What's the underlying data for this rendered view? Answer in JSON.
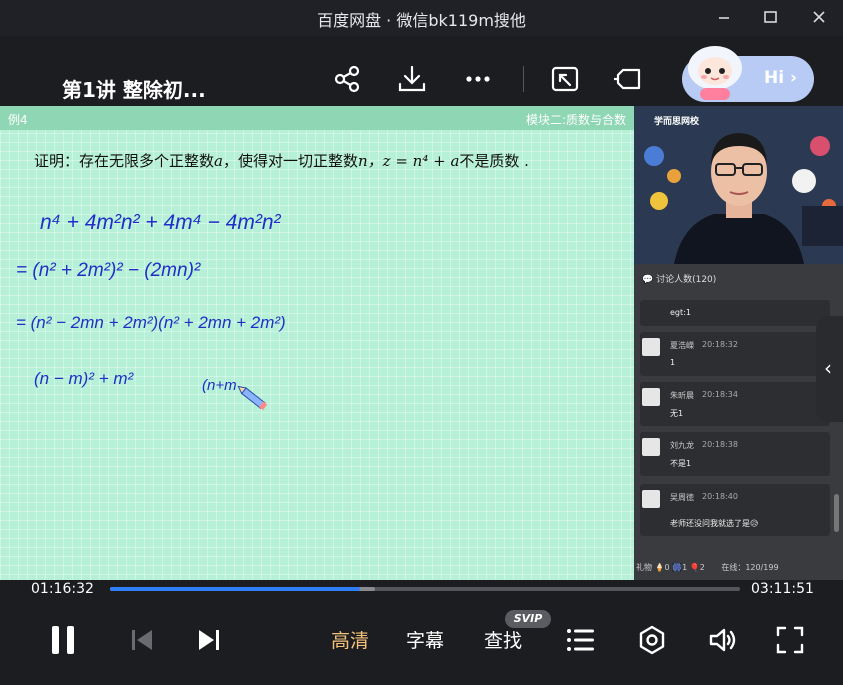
{
  "window": {
    "title": "百度网盘 · 微信bk119m搜他",
    "minimize_icon": "minimize-icon",
    "maximize_icon": "maximize-icon",
    "close_icon": "close-icon"
  },
  "header": {
    "lesson_title": "第1讲 整除初...",
    "buttons": [
      "share-icon",
      "download-icon",
      "more-icon",
      "screen-cast-icon",
      "picture-in-picture-icon"
    ],
    "assistant_label": "Hi ›"
  },
  "board": {
    "example_label": "例4",
    "module_label": "模块二:质数与合数",
    "problem_prefix": "证明：存在无限多个正整数",
    "problem_var_a": "a",
    "problem_mid": "，使得对一切正整数",
    "problem_var_n": "n",
    "problem_formula": "，z = n⁴ + a",
    "problem_suffix": "不是质数 .",
    "handwriting": [
      "n⁴ + 4m²n² + 4m⁴ − 4m²n²",
      "= (n² + 2m²)² − (2mn)²",
      "= (n² − 2mn + 2m²)(n² + 2mn + 2m²)",
      "(n − m)² + m²",
      "(n+m"
    ]
  },
  "camera": {
    "school_logo": "学而思网校"
  },
  "chat": {
    "header": "讨论人数(120)",
    "messages": [
      {
        "name": "",
        "time": "",
        "text": "egt:1"
      },
      {
        "name": "夏浩嶸",
        "time": "20:18:32",
        "text": "1"
      },
      {
        "name": "朱昕晨",
        "time": "20:18:34",
        "text": "无1"
      },
      {
        "name": "刘九龙",
        "time": "20:18:38",
        "text": "不是1"
      },
      {
        "name": "吴周徳",
        "time": "20:18:40",
        "text": "老师还没问我就选了是😥"
      }
    ],
    "footer_gifts": "礼物 🍦0 🎆1 🎈2",
    "footer_online": "在线：120/199"
  },
  "player": {
    "current_time": "01:16:32",
    "total_time": "03:11:51",
    "progress": 0.397,
    "buffered": 0.42,
    "quality_label": "高清",
    "subtitle_label": "字幕",
    "search_label": "查找",
    "svip_badge": "SVIP",
    "accent": "#2e7ff5",
    "quality_color": "#f5c27a"
  }
}
